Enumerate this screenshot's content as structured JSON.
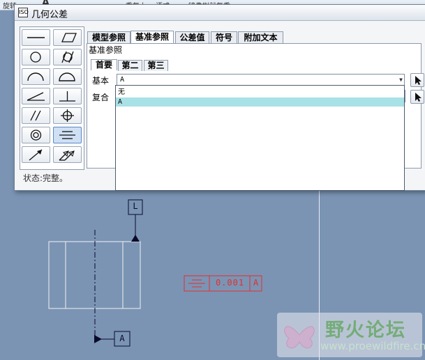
{
  "background_toolbar": {
    "items": [
      "旋转",
      "A",
      "重复上一 语式",
      "镜像拟就复重"
    ]
  },
  "dialog": {
    "title": "几何公差",
    "title_icon": "ISO",
    "tabs": [
      "模型参照",
      "基准参照",
      "公差值",
      "符号",
      "附加文本"
    ],
    "active_tab": "基准参照",
    "group_label": "基准参照",
    "subtabs": [
      "首要",
      "第二",
      "第三"
    ],
    "active_subtab": "首要",
    "basic_label": "基本",
    "compound_label": "复合",
    "basic_value": "A",
    "dropdown_options": [
      {
        "label": "无",
        "selected": false
      },
      {
        "label": "A",
        "selected": true
      }
    ],
    "status": "状态:完整。",
    "palette_symbols": [
      "straightness-icon",
      "flatness-icon",
      "circularity-icon",
      "cylindricity-icon",
      "line-profile-icon",
      "surface-profile-icon",
      "angularity-icon",
      "perpendicularity-icon",
      "parallelism-icon",
      "position-icon",
      "concentricity-icon",
      "symmetry-icon",
      "circular-runout-icon",
      "total-runout-icon"
    ],
    "selected_symbol": "symmetry-icon"
  },
  "drawing": {
    "datum_top": "L",
    "datum_bottom": "A",
    "fcf_tolerance": "0.001",
    "fcf_datum": "A",
    "fcf_color": "#e03030"
  },
  "watermark": {
    "brand": "野火论坛",
    "url": "www.proewildfire.cn"
  }
}
